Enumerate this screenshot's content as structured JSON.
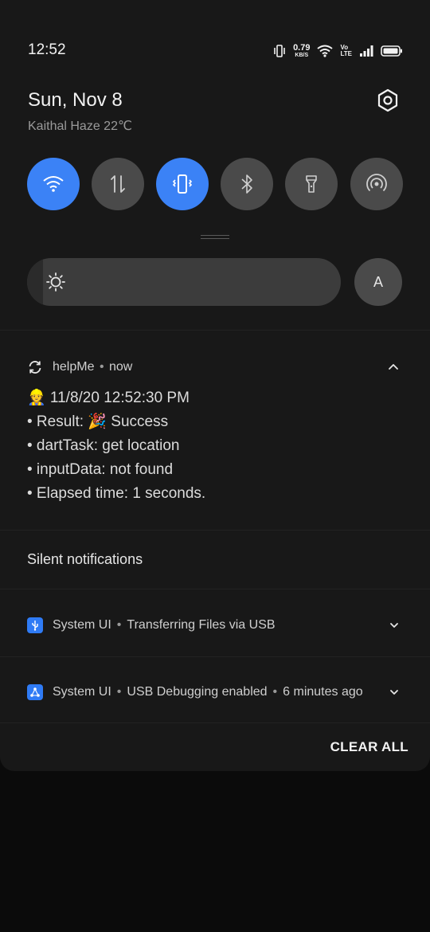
{
  "status_bar": {
    "time": "12:52",
    "net_speed_value": "0.79",
    "net_speed_unit": "KB/S",
    "volte_top": "Vo",
    "volte_bottom": "LTE",
    "icons": [
      "vibrate-icon",
      "wifi-icon",
      "signal-icon",
      "battery-icon"
    ]
  },
  "header": {
    "date": "Sun, Nov 8",
    "weather": "Kaithal Haze 22℃"
  },
  "quick_settings": {
    "tiles": [
      {
        "name": "wifi",
        "active": true
      },
      {
        "name": "mobile-data",
        "active": false
      },
      {
        "name": "vibrate",
        "active": true
      },
      {
        "name": "bluetooth",
        "active": false
      },
      {
        "name": "flashlight",
        "active": false
      },
      {
        "name": "hotspot",
        "active": false
      }
    ],
    "active_color": "#3b82f6",
    "inactive_color": "#4a4a4a"
  },
  "brightness": {
    "level": 0.05,
    "auto_label": "A"
  },
  "notification": {
    "app_name": "helpMe",
    "separator": "•",
    "when": "now",
    "lines": [
      "👷 11/8/20 12:52:30 PM",
      "• Result: 🎉 Success",
      "• dartTask: get location",
      "• inputData: not found",
      "• Elapsed time: 1 seconds."
    ]
  },
  "silent": {
    "title": "Silent notifications",
    "items": [
      {
        "app": "System UI",
        "separator": "•",
        "text": "Transferring Files via USB",
        "time": ""
      },
      {
        "app": "System UI",
        "separator": "•",
        "text": "USB Debugging enabled",
        "time": "6 minutes ago"
      }
    ]
  },
  "footer": {
    "clear_all": "CLEAR ALL"
  }
}
